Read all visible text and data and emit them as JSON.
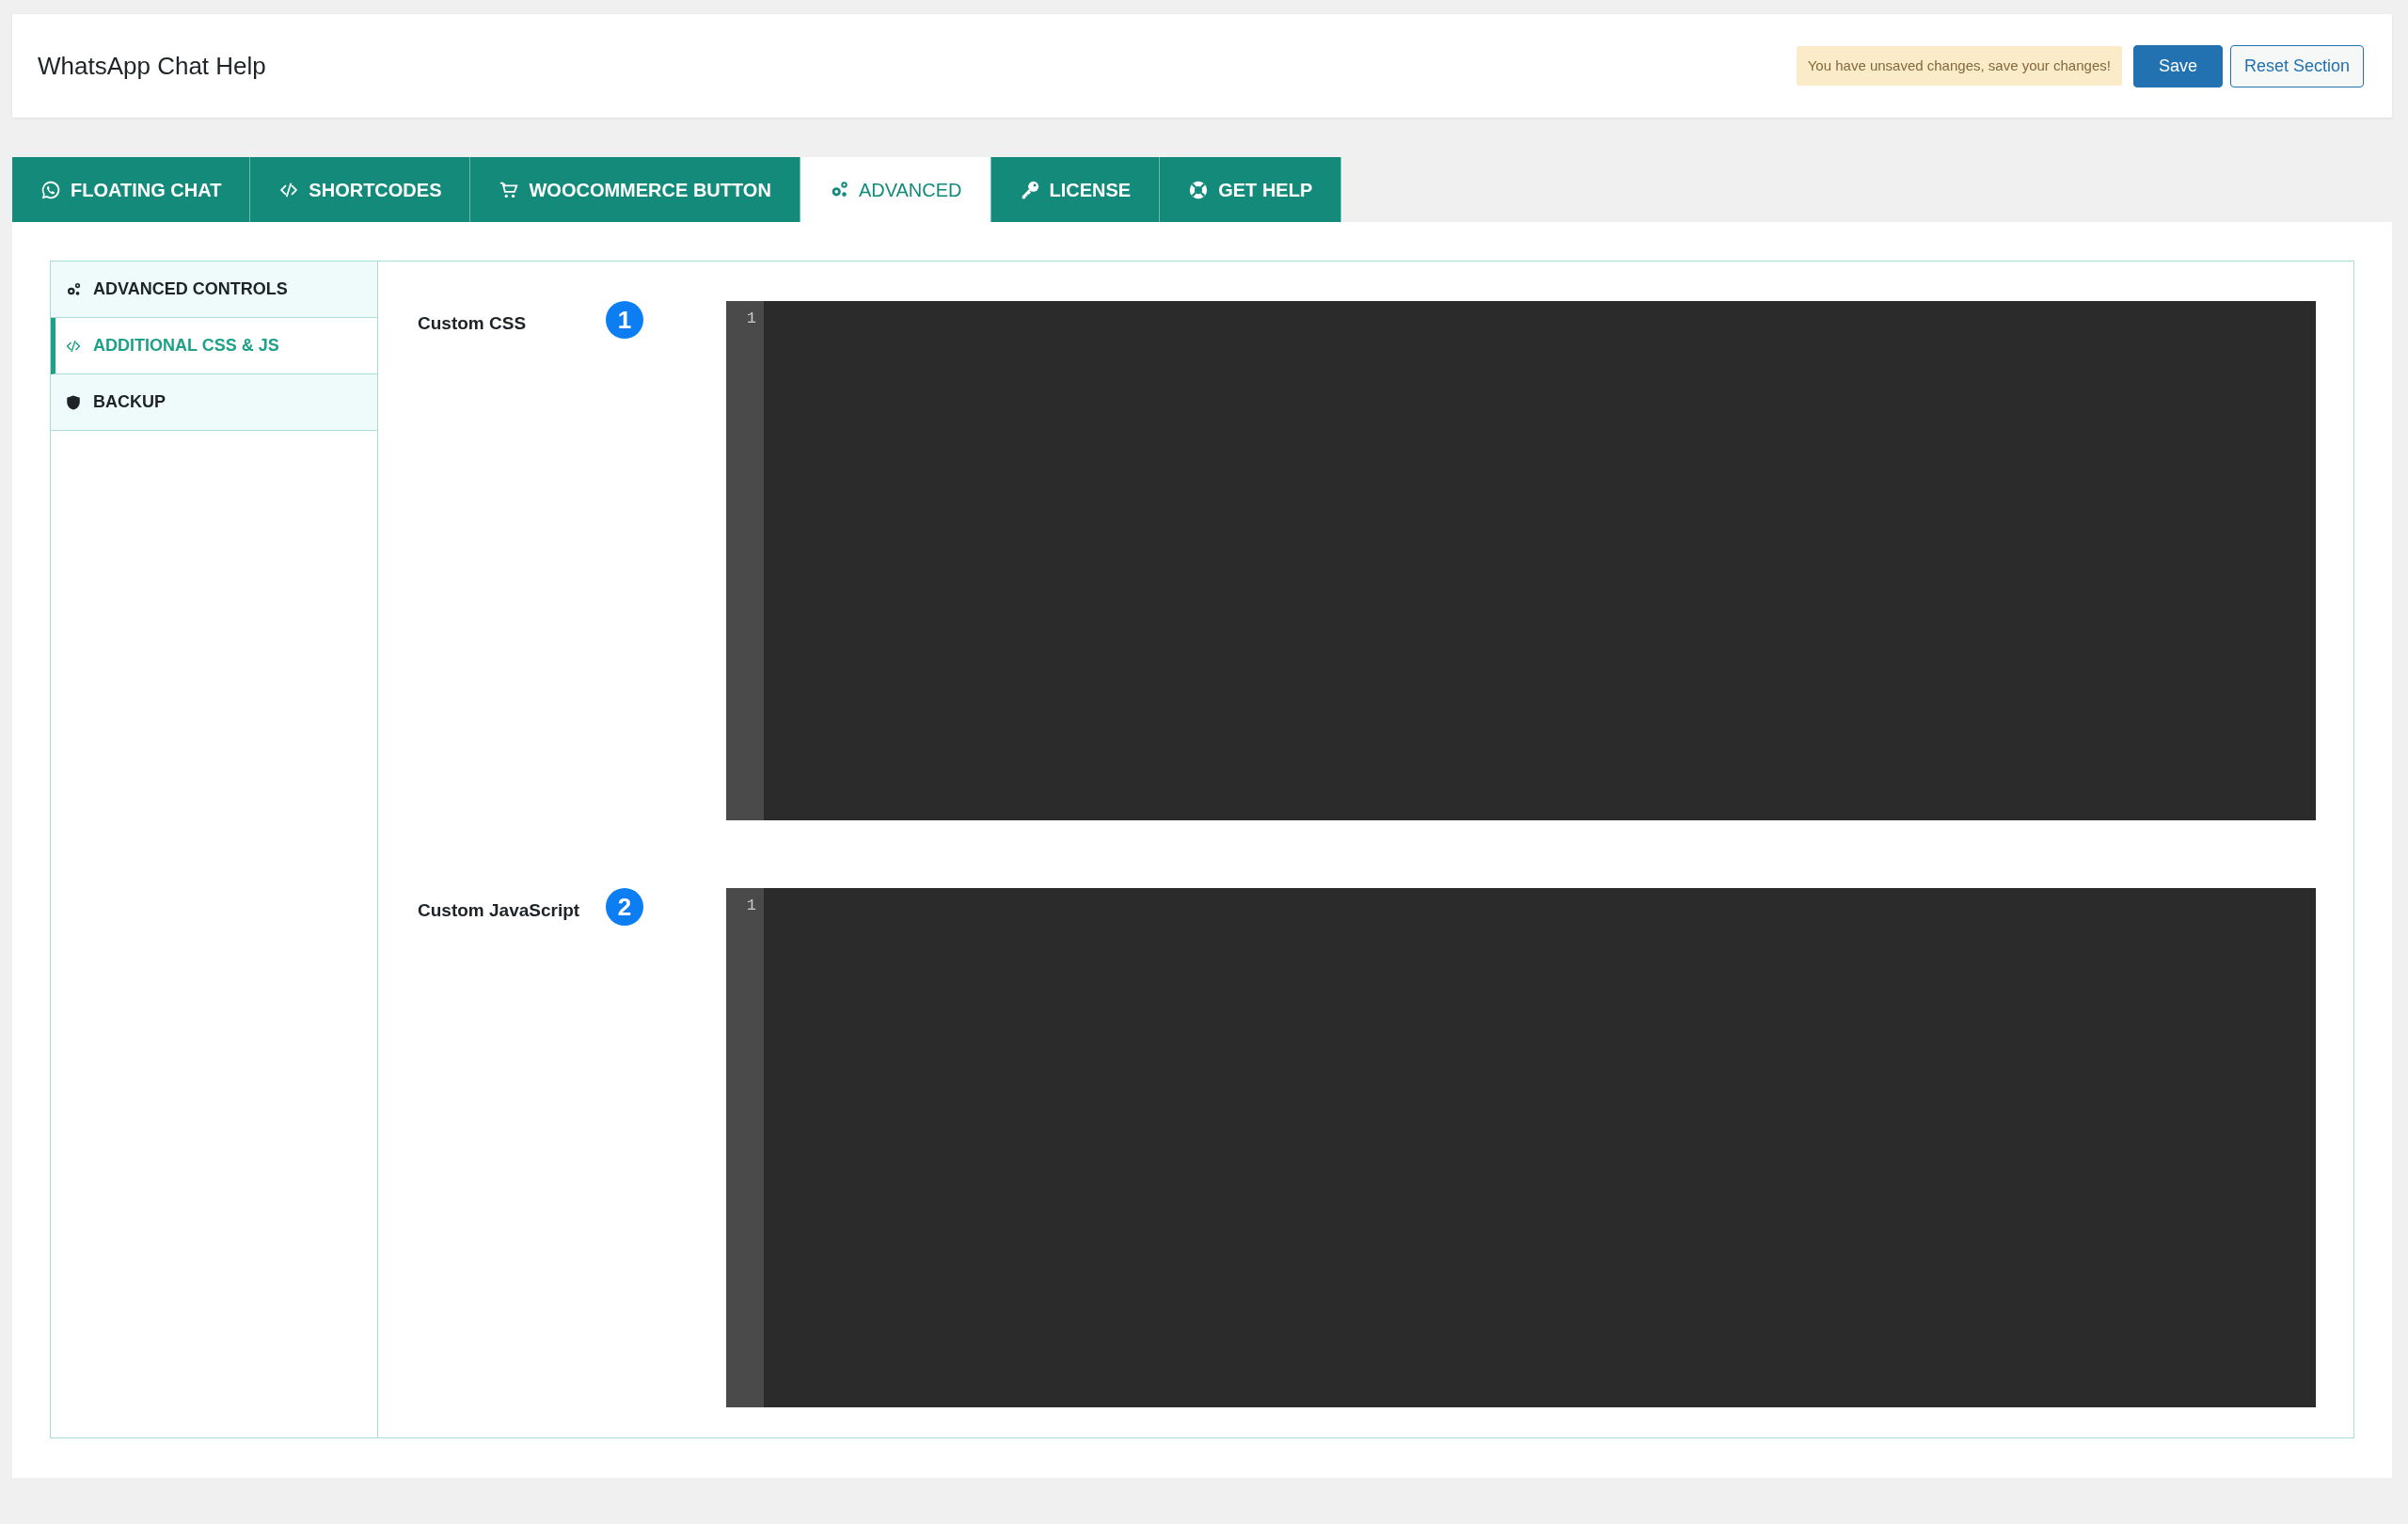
{
  "header": {
    "title": "WhatsApp Chat Help",
    "notice": "You have unsaved changes, save your changes!",
    "buttons": [
      {
        "label": "Save",
        "kind": "primary"
      },
      {
        "label": "Reset Section",
        "kind": "secondary"
      }
    ]
  },
  "tabs": [
    {
      "label": "FLOATING CHAT",
      "selected": false
    },
    {
      "label": "SHORTCODES",
      "selected": false
    },
    {
      "label": "WOOCOMMERCE BUTTON",
      "selected": false
    },
    {
      "label": "ADVANCED",
      "selected": true
    },
    {
      "label": "LICENSE",
      "selected": false
    },
    {
      "label": "GET HELP",
      "selected": false
    }
  ],
  "sidebar": {
    "items": [
      {
        "label": "ADVANCED CONTROLS",
        "selected": false
      },
      {
        "label": "ADDITIONAL CSS & JS",
        "selected": true
      },
      {
        "label": "BACKUP",
        "selected": false
      }
    ]
  },
  "fields": [
    {
      "label": "Custom CSS",
      "badge": "1",
      "line_number": "1"
    },
    {
      "label": "Custom JavaScript",
      "badge": "2",
      "line_number": "1"
    }
  ]
}
